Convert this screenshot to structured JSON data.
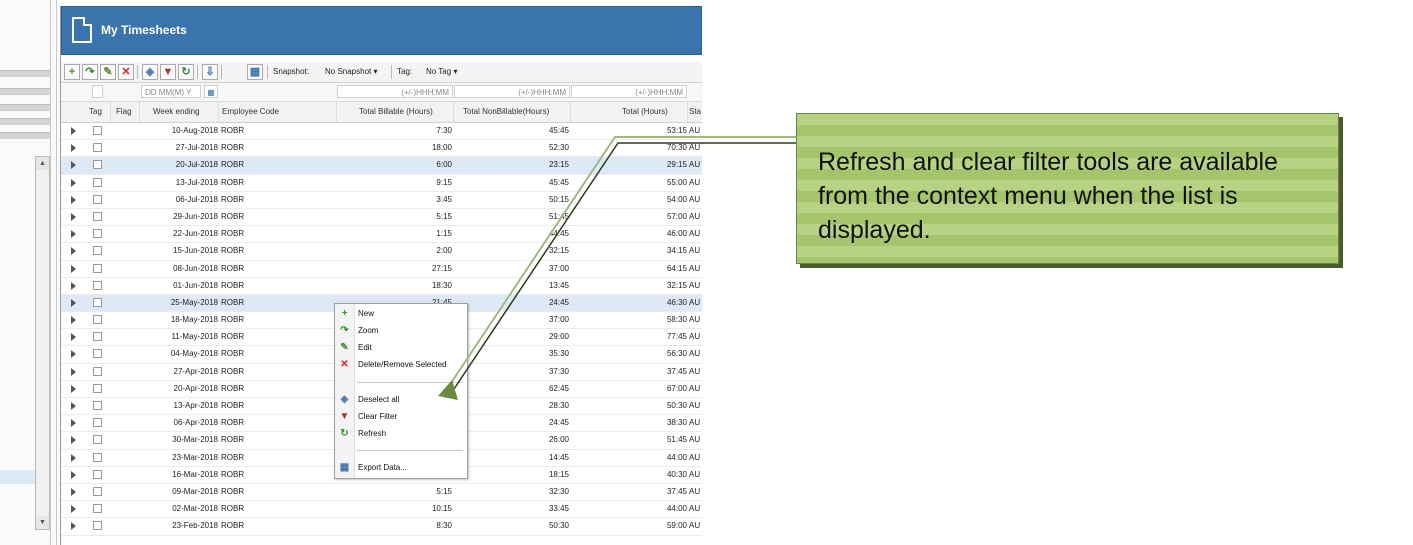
{
  "window": {
    "title": "My Timesheets"
  },
  "toolbar": {
    "snapshot_label": "Snapshot:",
    "snapshot_value": "No Snapshot",
    "tag_label": "Tag:",
    "tag_value": "No Tag"
  },
  "filters": {
    "date_placeholder": "DD MM(M) Y",
    "billable_placeholder": "(+/-)HHH:MM",
    "nonbillable_placeholder": "(+/-)HHH:MM",
    "total_placeholder": "(+/-)HHH:MM"
  },
  "columns": {
    "tag": "Tag",
    "flag": "Flag",
    "week_ending": "Week ending",
    "employee_code": "Employee Code",
    "billable": "Total Billable (Hours)",
    "nonbillable": "Total NonBillable(Hours)",
    "total": "Total (Hours)",
    "status": "Sta"
  },
  "rows": [
    {
      "week": "10-Aug-2018",
      "emp": "ROBR",
      "bil": "7:30",
      "nb": "45:45",
      "tot": "53:15",
      "st": "AU"
    },
    {
      "week": "27-Jul-2018",
      "emp": "ROBR",
      "bil": "18:00",
      "nb": "52:30",
      "tot": "70:30",
      "st": "AU"
    },
    {
      "week": "20-Jul-2018",
      "emp": "ROBR",
      "bil": "6:00",
      "nb": "23:15",
      "tot": "29:15",
      "st": "AU"
    },
    {
      "week": "13-Jul-2018",
      "emp": "ROBR",
      "bil": "9:15",
      "nb": "45:45",
      "tot": "55:00",
      "st": "AU"
    },
    {
      "week": "06-Jul-2018",
      "emp": "ROBR",
      "bil": "3:45",
      "nb": "50:15",
      "tot": "54:00",
      "st": "AU"
    },
    {
      "week": "29-Jun-2018",
      "emp": "ROBR",
      "bil": "5:15",
      "nb": "51:45",
      "tot": "57:00",
      "st": "AU"
    },
    {
      "week": "22-Jun-2018",
      "emp": "ROBR",
      "bil": "1:15",
      "nb": "44:45",
      "tot": "46:00",
      "st": "AU"
    },
    {
      "week": "15-Jun-2018",
      "emp": "ROBR",
      "bil": "2:00",
      "nb": "32:15",
      "tot": "34:15",
      "st": "AU"
    },
    {
      "week": "08-Jun-2018",
      "emp": "ROBR",
      "bil": "27:15",
      "nb": "37:00",
      "tot": "64:15",
      "st": "AU"
    },
    {
      "week": "01-Jun-2018",
      "emp": "ROBR",
      "bil": "18:30",
      "nb": "13:45",
      "tot": "32:15",
      "st": "AU"
    },
    {
      "week": "25-May-2018",
      "emp": "ROBR",
      "bil": "21:45",
      "nb": "24:45",
      "tot": "46:30",
      "st": "AU"
    },
    {
      "week": "18-May-2018",
      "emp": "ROBR",
      "bil": "",
      "nb": "37:00",
      "tot": "58:30",
      "st": "AU"
    },
    {
      "week": "11-May-2018",
      "emp": "ROBR",
      "bil": "",
      "nb": "29:00",
      "tot": "77:45",
      "st": "AU"
    },
    {
      "week": "04-May-2018",
      "emp": "ROBR",
      "bil": "",
      "nb": "35:30",
      "tot": "56:30",
      "st": "AU"
    },
    {
      "week": "27-Apr-2018",
      "emp": "ROBR",
      "bil": "",
      "nb": "37:30",
      "tot": "37:45",
      "st": "AU"
    },
    {
      "week": "20-Apr-2018",
      "emp": "ROBR",
      "bil": "",
      "nb": "62:45",
      "tot": "67:00",
      "st": "AU"
    },
    {
      "week": "13-Apr-2018",
      "emp": "ROBR",
      "bil": "",
      "nb": "28:30",
      "tot": "50:30",
      "st": "AU"
    },
    {
      "week": "06-Apr-2018",
      "emp": "ROBR",
      "bil": "",
      "nb": "24:45",
      "tot": "38:30",
      "st": "AU"
    },
    {
      "week": "30-Mar-2018",
      "emp": "ROBR",
      "bil": "",
      "nb": "26:00",
      "tot": "51:45",
      "st": "AU"
    },
    {
      "week": "23-Mar-2018",
      "emp": "ROBR",
      "bil": "",
      "nb": "14:45",
      "tot": "44:00",
      "st": "AU"
    },
    {
      "week": "16-Mar-2018",
      "emp": "ROBR",
      "bil": "22:15",
      "nb": "18:15",
      "tot": "40:30",
      "st": "AU"
    },
    {
      "week": "09-Mar-2018",
      "emp": "ROBR",
      "bil": "5:15",
      "nb": "32:30",
      "tot": "37:45",
      "st": "AU"
    },
    {
      "week": "02-Mar-2018",
      "emp": "ROBR",
      "bil": "10:15",
      "nb": "33:45",
      "tot": "44:00",
      "st": "AU"
    },
    {
      "week": "23-Feb-2018",
      "emp": "ROBR",
      "bil": "8:30",
      "nb": "50:30",
      "tot": "59:00",
      "st": "AU"
    }
  ],
  "context_menu": {
    "new": "New",
    "zoom": "Zoom",
    "edit": "Edit",
    "delete": "Delete/Remove Selected",
    "deselect": "Deselect all",
    "clear_filter": "Clear Filter",
    "refresh": "Refresh",
    "export": "Export Data..."
  },
  "callout": {
    "text": "Refresh and clear filter tools are available from the context menu when the list is displayed."
  },
  "colors": {
    "title_bar": "#3b74ad",
    "row_highlight": "#dde9f7",
    "callout_fill": "#a4c56c",
    "callout_line": "#6b8a3f"
  }
}
